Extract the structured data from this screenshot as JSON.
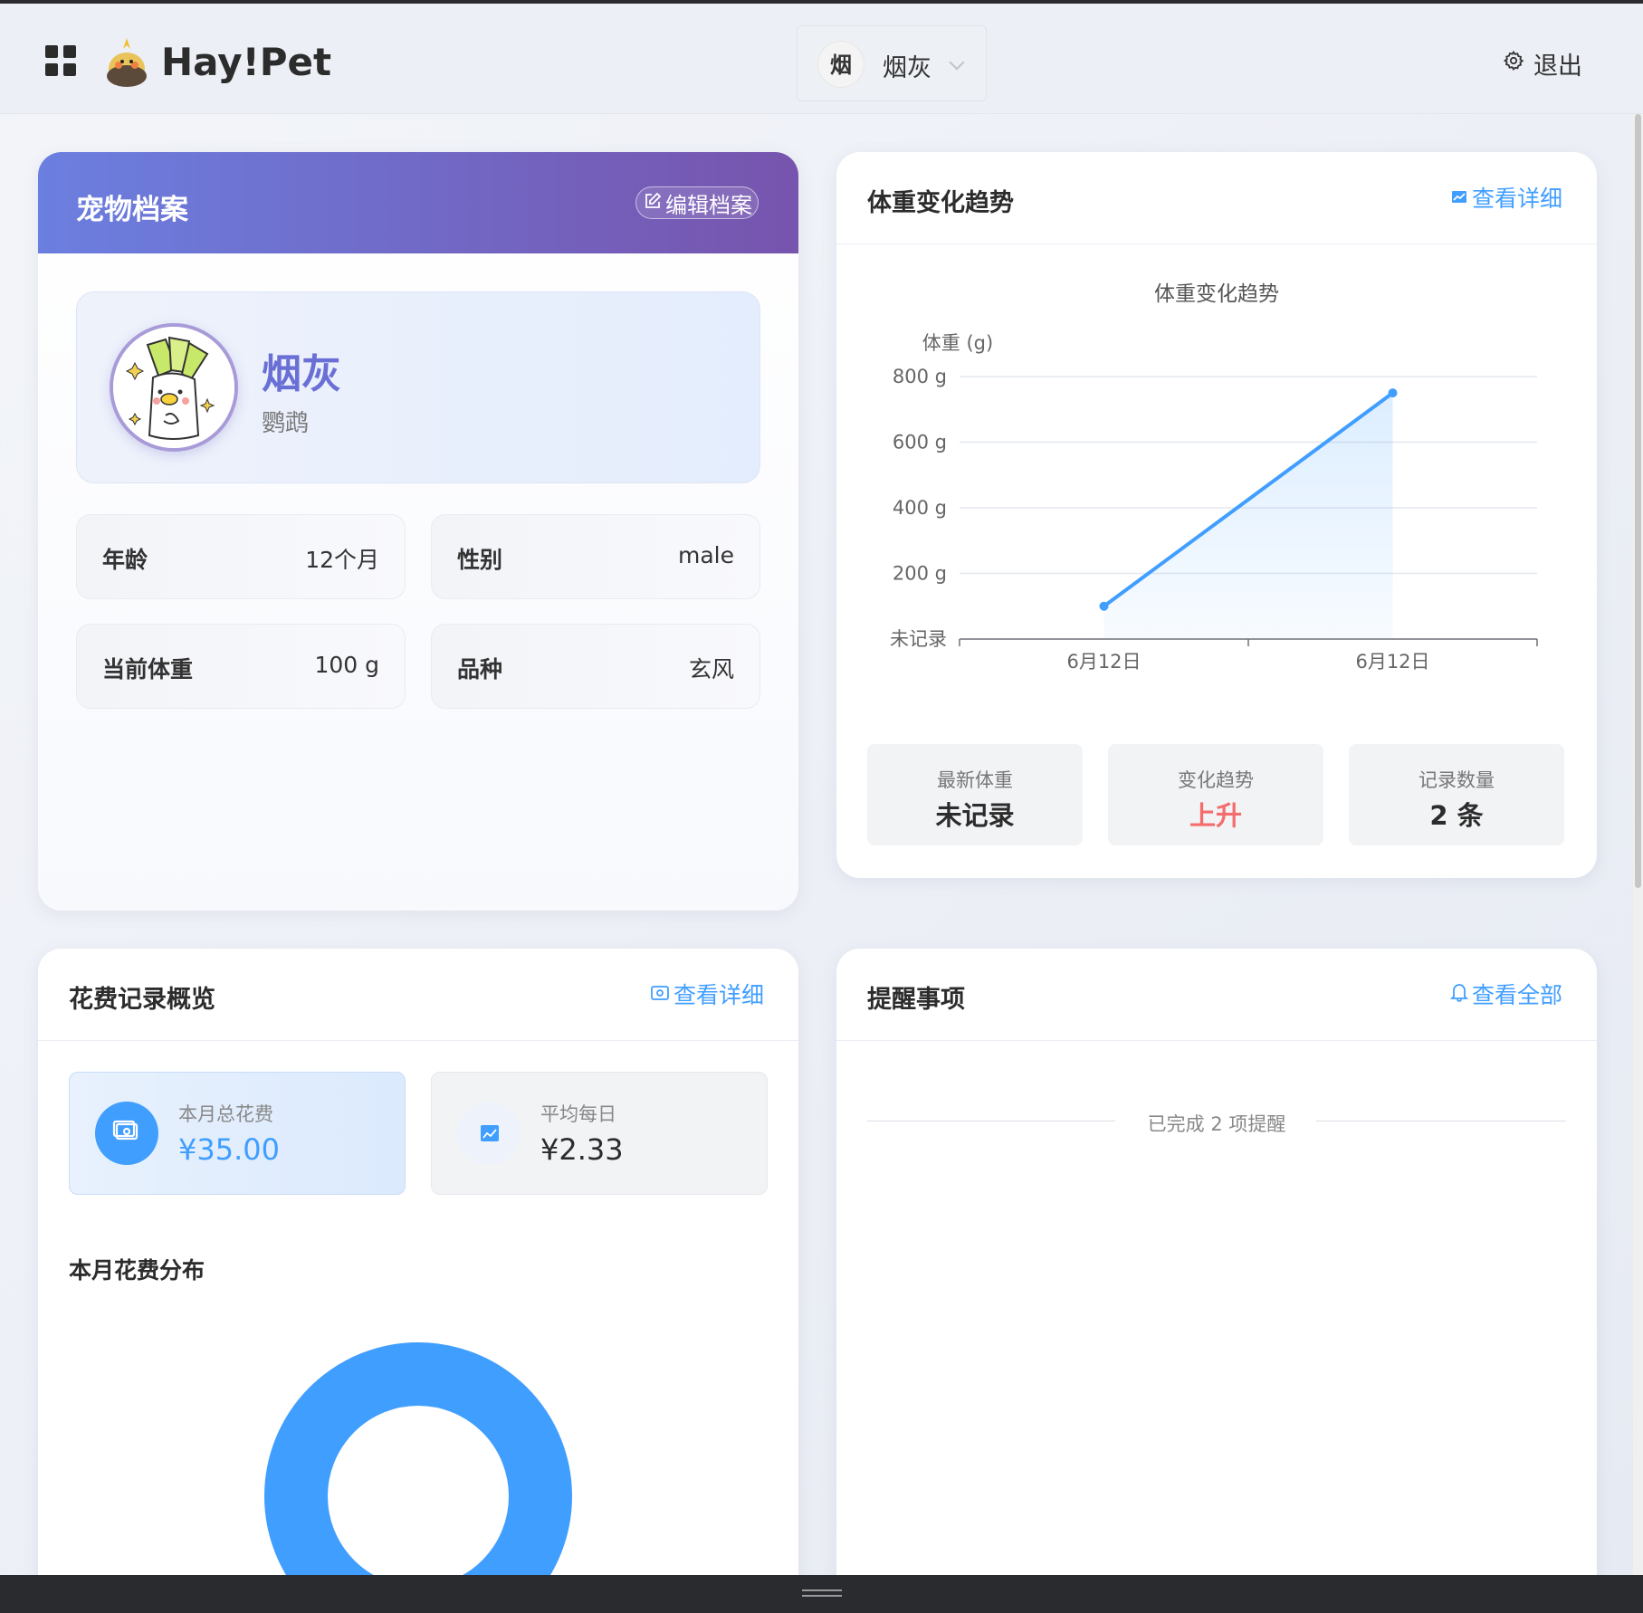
{
  "app": {
    "brand": "Hay!Pet",
    "logout_label": "退出"
  },
  "pet_switcher": {
    "avatar_char": "烟",
    "name": "烟灰"
  },
  "profile": {
    "title": "宠物档案",
    "edit_label": "编辑档案",
    "pet_name": "烟灰",
    "species": "鹦鹉",
    "fields": [
      {
        "label": "年龄",
        "value": "12个月"
      },
      {
        "label": "性别",
        "value": "male"
      },
      {
        "label": "当前体重",
        "value": "100 g"
      },
      {
        "label": "品种",
        "value": "玄风"
      }
    ]
  },
  "weight": {
    "title": "体重变化趋势",
    "detail_label": "查看详细",
    "stats": [
      {
        "label": "最新体重",
        "value": "未记录",
        "color": "#2c2c2c"
      },
      {
        "label": "变化趋势",
        "value": "上升",
        "color": "#f56c6c"
      },
      {
        "label": "记录数量",
        "value": "2 条",
        "color": "#2c2c2c"
      }
    ]
  },
  "chart_data": {
    "type": "area",
    "title": "体重变化趋势",
    "ylabel": "体重 (g)",
    "xlabel": "",
    "x": [
      "6月12日",
      "6月12日"
    ],
    "series": [
      {
        "values": [
          100,
          750
        ]
      }
    ],
    "ylim": [
      0,
      800
    ],
    "yticks": [
      0,
      200,
      400,
      600,
      800
    ],
    "ytick_labels": [
      "未记录",
      "200 g",
      "400 g",
      "600 g",
      "800 g"
    ],
    "grid": true,
    "line_color": "#409eff"
  },
  "expense": {
    "title": "花费记录概览",
    "detail_label": "查看详细",
    "month_total_label": "本月总花费",
    "month_total_value": "¥35.00",
    "daily_avg_label": "平均每日",
    "daily_avg_value": "¥2.33",
    "distribution_title": "本月花费分布",
    "distribution": {
      "type": "pie",
      "slices": [
        {
          "value": 35.0,
          "color": "#409eff"
        }
      ]
    }
  },
  "reminders": {
    "title": "提醒事项",
    "view_all_label": "查看全部",
    "completed_text": "已完成 2 项提醒"
  },
  "colors": {
    "accent": "#409eff",
    "profile_gradient_start": "#6b7fe0",
    "profile_gradient_end": "#7754ad",
    "trend_up": "#f56c6c"
  }
}
